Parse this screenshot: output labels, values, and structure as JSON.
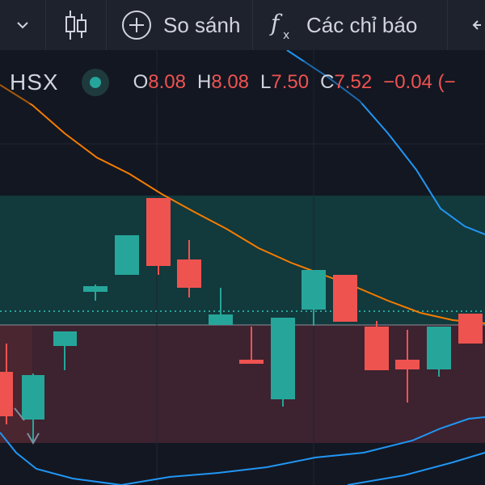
{
  "toolbar": {
    "compare_label": "So sánh",
    "indicators_label": "Các chỉ báo",
    "icons": [
      "chevron-down-icon",
      "candlestick-icon",
      "plus-circle-icon",
      "function-icon",
      "arrow-left-icon"
    ]
  },
  "legend": {
    "symbol": "HSX",
    "open_key": "O",
    "open": "8.08",
    "high_key": "H",
    "high": "8.08",
    "low_key": "L",
    "low": "7.50",
    "close_key": "C",
    "close": "7.52",
    "change": "−0.04 (−"
  },
  "colors": {
    "background": "#131722",
    "toolbar": "#1e222d",
    "up": "#26a69a",
    "down": "#ef5350",
    "ma_line": "#f57c00",
    "bollinger": "#2196f3",
    "zone_upper": "#123a3d",
    "zone_lower": "#3d2330"
  }
}
